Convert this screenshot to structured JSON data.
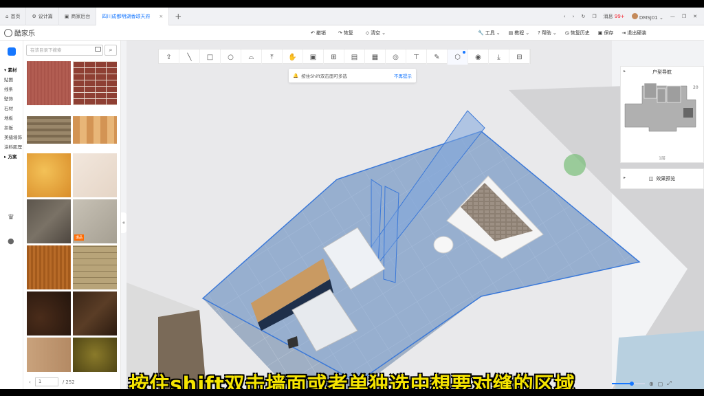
{
  "browser": {
    "tabs": [
      {
        "label": "首页"
      },
      {
        "label": "设计篇"
      },
      {
        "label": "商家后台"
      },
      {
        "label": "四川成都明湖香颂天府"
      }
    ],
    "notifications_label": "消息",
    "notifications_count": "99+",
    "user": "DMSJ01"
  },
  "header": {
    "logo": "酷家乐",
    "undo": "撤销",
    "redo": "恢复",
    "clear": "清空",
    "tools": "工具",
    "tutorial": "教程",
    "help": "帮助",
    "history": "恢复历史",
    "save": "保存",
    "exit": "退出硬装"
  },
  "rail": {
    "categories": [
      "素材",
      "贴图",
      "线条",
      "壁饰",
      "石材",
      "地板",
      "扣板",
      "美缝墙饰",
      "涂料肌理",
      "方案"
    ]
  },
  "panel": {
    "search_placeholder": "在该目录下搜索",
    "hot_tag": "爆品",
    "page_current": "1",
    "page_total": "/ 252"
  },
  "hint": {
    "text": "按住Shift双击面可多选",
    "dismiss": "不再提示"
  },
  "floorplan_nav": {
    "title": "户型导航",
    "floor": "1层",
    "room_label": "20"
  },
  "preview": {
    "label": "效果预览"
  },
  "subtitle": "按住shift双击墙面或者单独选中想要对缝的区域",
  "colors": {
    "accent": "#1677ff",
    "selection_fill": "#8fb0dd",
    "subtitle": "#f5e400"
  }
}
